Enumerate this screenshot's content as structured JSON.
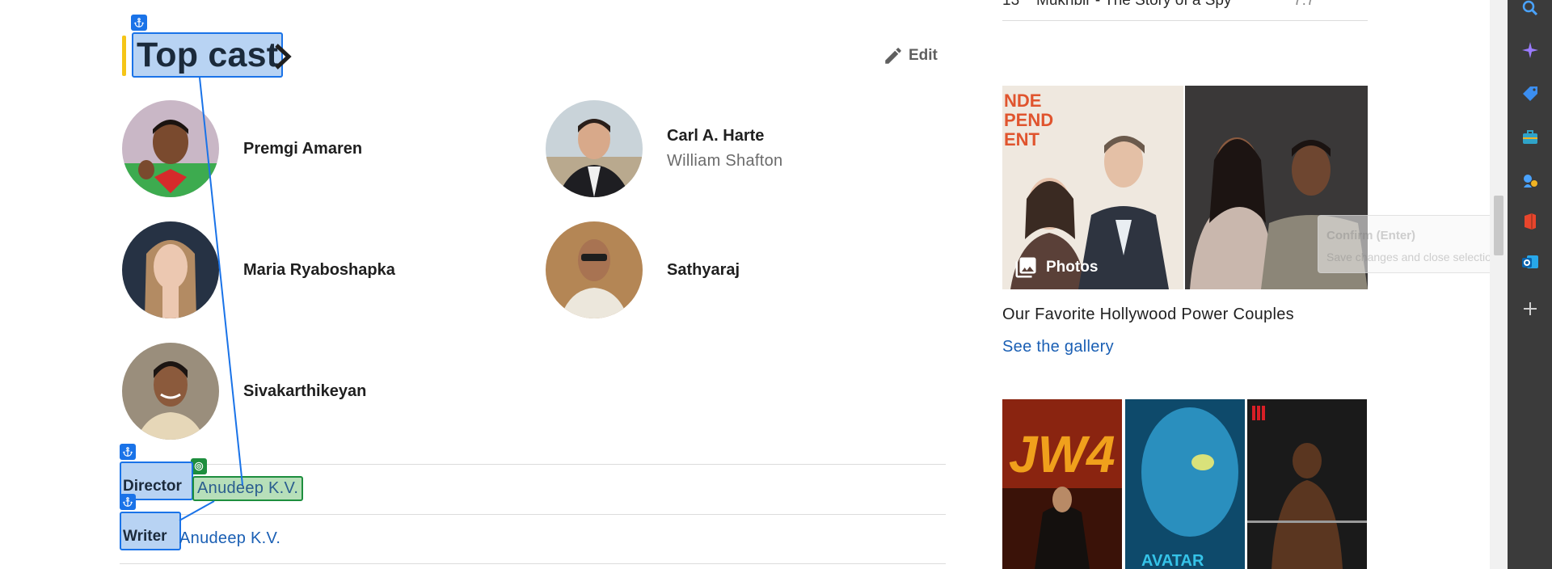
{
  "top_strip": {
    "rank": "13",
    "title": "Mukhbir - The Story of a Spy",
    "rating": "7.7"
  },
  "section": {
    "title": "Top cast",
    "edit_label": "Edit"
  },
  "cast": [
    {
      "name": "Premgi Amaren",
      "role": ""
    },
    {
      "name": "Carl A. Harte",
      "role": "William Shafton"
    },
    {
      "name": "Maria Ryaboshapka",
      "role": ""
    },
    {
      "name": "Sathyaraj",
      "role": ""
    },
    {
      "name": "Sivakarthikeyan",
      "role": ""
    }
  ],
  "credits": [
    {
      "label": "Director",
      "value": "Anudeep K.V."
    },
    {
      "label": "Writer",
      "value": "Anudeep K.V."
    }
  ],
  "gallery": {
    "badge": "Photos",
    "title": "Our Favorite Hollywood Power Couples",
    "link": "See the gallery"
  },
  "tooltip": {
    "title": "Confirm (Enter)",
    "body": "Save changes and close selection wizard"
  },
  "sidebar_icons": [
    "search-icon",
    "copilot-icon",
    "shopping-tag-icon",
    "briefcase-icon",
    "games-icon",
    "office-icon",
    "outlook-icon",
    "add-icon"
  ],
  "colors": {
    "accent": "#f5c518",
    "link": "#1a5fb4",
    "selection_blue": "#1a73e8",
    "selection_green": "#1e8e3e",
    "edge_sidebar": "#3b3b3b"
  }
}
